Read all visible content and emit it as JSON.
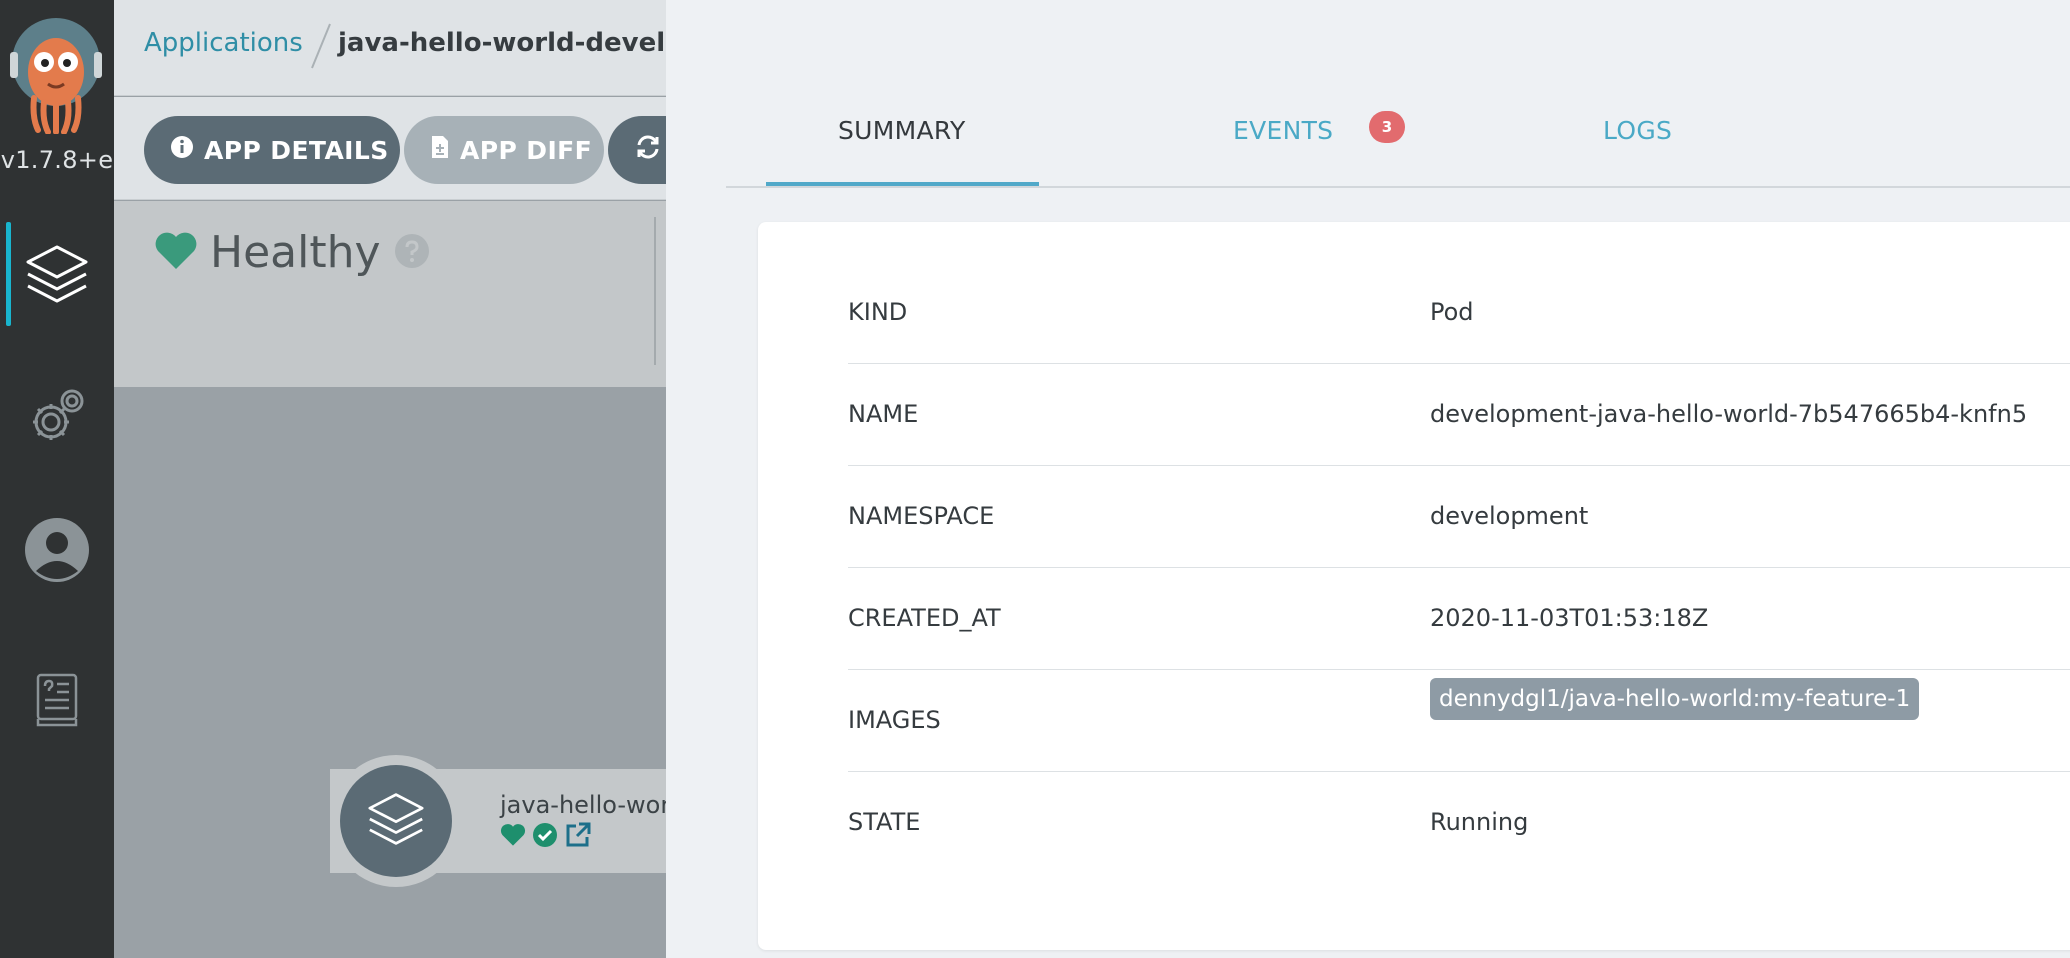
{
  "sidebar": {
    "version": "v1.7.8+e",
    "items": [
      {
        "name": "applications",
        "icon": "layers-icon",
        "active": true
      },
      {
        "name": "settings",
        "icon": "gears-icon",
        "active": false
      },
      {
        "name": "user-info",
        "icon": "user-icon",
        "active": false
      },
      {
        "name": "documentation",
        "icon": "docs-icon",
        "active": false
      }
    ]
  },
  "breadcrumb": {
    "link": "Applications",
    "current": "java-hello-world-developmen"
  },
  "toolbar": {
    "app_details": "APP DETAILS",
    "app_diff": "APP DIFF"
  },
  "status": {
    "health": "Healthy"
  },
  "tree": {
    "node_name": "java-hello-worl"
  },
  "panel": {
    "tabs": [
      {
        "label": "SUMMARY",
        "active": true
      },
      {
        "label": "EVENTS",
        "badge": "3"
      },
      {
        "label": "LOGS"
      }
    ],
    "summary": {
      "kind_label": "KIND",
      "kind": "Pod",
      "name_label": "NAME",
      "name": "development-java-hello-world-7b547665b4-knfn5",
      "namespace_label": "NAMESPACE",
      "namespace": "development",
      "created_label": "CREATED_AT",
      "created_at": "2020-11-03T01:53:18Z",
      "images_label": "IMAGES",
      "image": "dennydgl1/java-hello-world:my-feature-1",
      "state_label": "STATE",
      "state": "Running"
    }
  },
  "colors": {
    "accent": "#51a9c9",
    "healthy": "#18be94",
    "badge": "#e26b6e",
    "sidebar_bg": "#2f3233"
  }
}
